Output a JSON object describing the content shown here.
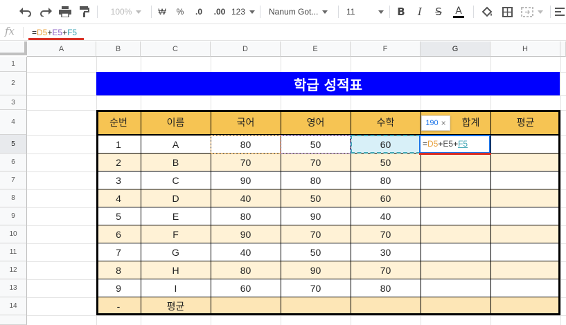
{
  "toolbar": {
    "zoom": "100%",
    "currency": "₩",
    "percent": "%",
    "dec_decrease": ".0",
    "dec_increase": ".00",
    "format_more": "123",
    "font_name": "Nanum Got...",
    "font_size": "11"
  },
  "formula_bar": {
    "fx": "fx",
    "parts": [
      "=",
      "D5",
      "+",
      "E5",
      "+",
      "F5"
    ]
  },
  "colors": {
    "title_bg": "#0000ff",
    "header_bg": "#f6c453",
    "stripe_bg": "#fff2d6",
    "avg_bg": "#fde6b6",
    "ref_d": "#e8a13d",
    "ref_e": "#8e63c6",
    "ref_f": "#3fa6b5",
    "selection": "#1a73e8",
    "underline": "#d93025"
  },
  "columns": [
    "A",
    "B",
    "C",
    "D",
    "E",
    "F",
    "G",
    "H"
  ],
  "rows": [
    "1",
    "2",
    "3",
    "4",
    "5",
    "6",
    "7",
    "8",
    "9",
    "10",
    "11",
    "12",
    "13",
    "14"
  ],
  "sheet": {
    "title": "학급 성적표",
    "headers": [
      "순번",
      "이름",
      "국어",
      "영어",
      "수학",
      "합계",
      "평균"
    ],
    "data": [
      [
        "1",
        "A",
        "80",
        "50",
        "60"
      ],
      [
        "2",
        "B",
        "70",
        "70",
        "50"
      ],
      [
        "3",
        "C",
        "90",
        "80",
        "80"
      ],
      [
        "4",
        "D",
        "40",
        "50",
        "60"
      ],
      [
        "5",
        "E",
        "80",
        "90",
        "40"
      ],
      [
        "6",
        "F",
        "90",
        "70",
        "70"
      ],
      [
        "7",
        "G",
        "40",
        "50",
        "30"
      ],
      [
        "8",
        "H",
        "80",
        "90",
        "70"
      ],
      [
        "9",
        "I",
        "60",
        "70",
        "80"
      ]
    ],
    "footer": [
      "-",
      "평균"
    ]
  },
  "active_cell": {
    "parts": [
      "=",
      "D5",
      "+",
      "E5",
      "+",
      "F5"
    ]
  },
  "tooltip": {
    "value": "190",
    "close": "×"
  }
}
